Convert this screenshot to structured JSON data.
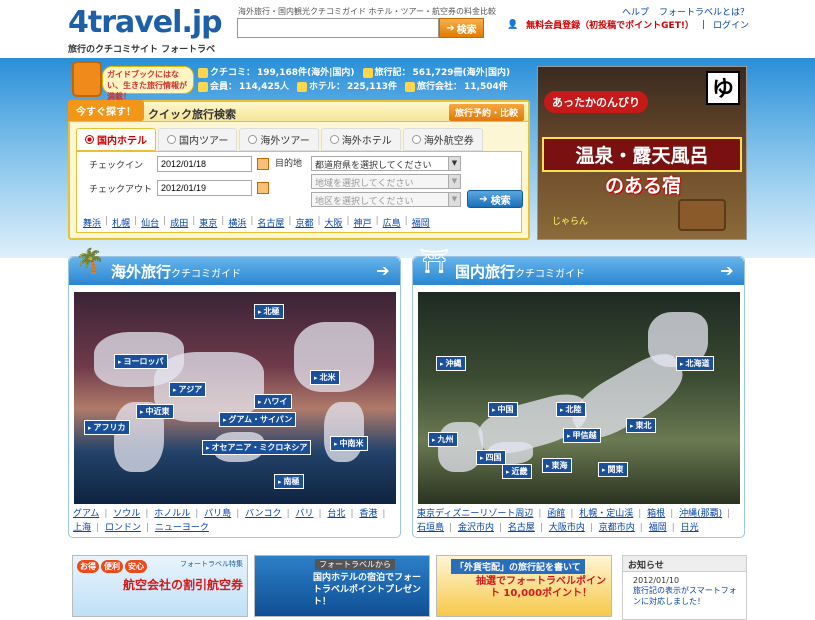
{
  "header": {
    "logo_text": "4travel.jp",
    "logo_sub": "旅行のクチコミサイト フォートラベル",
    "tagline": "海外旅行・国内観光クチコミガイド ホテル・ツアー・航空券の料金比較",
    "search_placeholder": "",
    "search_button": "検索",
    "help": "ヘルプ",
    "about": "フォートラベルとは？",
    "register": "無料会員登録（初投稿でポイントGET!）",
    "login": "ログイン"
  },
  "mascot": {
    "bubble": "ガイドブックにはない、生きた旅行情報が満載！"
  },
  "stats": {
    "reviews_label": "クチコミ：",
    "reviews_value": "199,168件(海外|国内)",
    "travelogues_label": "旅行記：",
    "travelogues_value": "561,729冊(海外|国内)",
    "members_label": "会員：",
    "members_value": "114,425人",
    "hotels_label": "ホテル：",
    "hotels_value": "225,113件",
    "agencies_label": "旅行会社：",
    "agencies_value": "11,504件"
  },
  "quick_search": {
    "badge": "今すぐ探す！",
    "title": "クイック旅行検索",
    "more": "旅行予約・比較",
    "tabs": [
      {
        "label": "国内ホテル",
        "active": true
      },
      {
        "label": "国内ツアー",
        "active": false
      },
      {
        "label": "海外ツアー",
        "active": false
      },
      {
        "label": "海外ホテル",
        "active": false
      },
      {
        "label": "海外航空券",
        "active": false
      }
    ],
    "checkin_label": "チェックイン",
    "checkin_value": "2012/01/18",
    "checkout_label": "チェックアウト",
    "checkout_value": "2012/01/19",
    "destination_label": "目的地",
    "prefecture": "都道府県を選択してください",
    "area": "地域を選択してください",
    "district": "地区を選択してください",
    "submit": "検索",
    "cities": [
      "舞浜",
      "札幌",
      "仙台",
      "成田",
      "東京",
      "横浜",
      "名古屋",
      "京都",
      "大阪",
      "神戸",
      "広島",
      "福岡"
    ]
  },
  "ad": {
    "tagline": "あったかのんびり",
    "badge": "ゆ",
    "main": "温泉・露天風呂",
    "sub": "のある宿",
    "footer": "じゃらん"
  },
  "overseas": {
    "title": "海外旅行",
    "subtitle": "クチコミガイド",
    "regions": [
      "北極",
      "ヨーロッパ",
      "アジア",
      "中近東",
      "北米",
      "ハワイ",
      "グアム・サイパン",
      "アフリカ",
      "オセアニア・ミクロネシア",
      "中南米",
      "南極"
    ],
    "links": [
      "グアム",
      "ソウル",
      "ホノルル",
      "パリ島",
      "バンコク",
      "バリ",
      "台北",
      "香港",
      "上海",
      "ロンドン",
      "ニューヨーク"
    ]
  },
  "domestic": {
    "title": "国内旅行",
    "subtitle": "クチコミガイド",
    "regions": [
      "沖縄",
      "北海道",
      "中国",
      "北陸",
      "東北",
      "九州",
      "甲信越",
      "四国",
      "近畿",
      "東海",
      "関東"
    ],
    "links": [
      "東京ディズニーリゾート周辺",
      "函館",
      "箱根",
      "沖縄(那覇)",
      "石垣島",
      "金沢市内",
      "名古屋",
      "大阪市内",
      "京都市内",
      "福岡",
      "日光",
      "札幌・定山渓"
    ]
  },
  "promos": [
    {
      "top": "フォートラベル特集",
      "main": "航空会社の割引航空券",
      "badges": [
        "お得",
        "便利",
        "安心"
      ]
    },
    {
      "top": "フォートラベルから",
      "main": "国内ホテルの宿泊でフォートラベルポイントプレゼント！"
    },
    {
      "top": "「外貨宅配」の旅行記を書いて",
      "main": "抽選でフォートラベルポイント 10,000ポイント！"
    }
  ],
  "news": {
    "heading": "お知らせ",
    "date": "2012/01/10",
    "text": "旅行記の表示がスマートフォンに対応しました！"
  },
  "colors": {
    "accent_blue": "#2a86d0",
    "accent_orange": "#f29618",
    "link": "#0645ad"
  }
}
